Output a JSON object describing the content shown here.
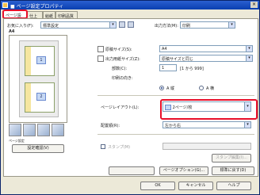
{
  "window": {
    "title": "■ ページ設定プロパティ"
  },
  "tabs": [
    {
      "label": "ページ設定"
    },
    {
      "label": "仕上げ"
    },
    {
      "label": "給紙"
    },
    {
      "label": "印刷品質"
    }
  ],
  "top_row": {
    "favorites_label": "お気に入り(F):",
    "favorites_value": "標準設定",
    "output_label": "出力方法(M):",
    "output_value": "印刷"
  },
  "left": {
    "size_label": "A4",
    "page_numbers": [
      "1",
      "2"
    ],
    "caption": "ページ設定",
    "view_settings_button": "設定確認(V)"
  },
  "right": {
    "original_size_label": "原稿サイズ(S):",
    "original_size_value": "A4",
    "output_size_label": "出力用紙サイズ(Z):",
    "output_size_value": "原稿サイズと同じ",
    "copies_label": "部数(C):",
    "copies_value": "1",
    "copies_range": "[1 から 999]",
    "orientation_label": "印刷の向き:",
    "portrait_label": "A 縦",
    "landscape_label": "A 横",
    "layout_label": "ページレイアウト(L):",
    "layout_value": "2ページ/枚",
    "order_label": "配置順(R):",
    "order_value": "左から右",
    "stamp_label": "スタンプ(M)",
    "stamp_value": "",
    "stamp_edit_button": "スタンプ編集(I)...",
    "page_options_button": "ページオプション(G)...",
    "restore_button": "標準に戻す(D)"
  },
  "bottom": {
    "ok": "OK",
    "cancel": "キャンセル",
    "help": "ヘルプ"
  },
  "colors": {
    "highlight": "#e8102a",
    "title_bar": "#0a3fb0",
    "dialog_bg": "#ece9d8"
  }
}
